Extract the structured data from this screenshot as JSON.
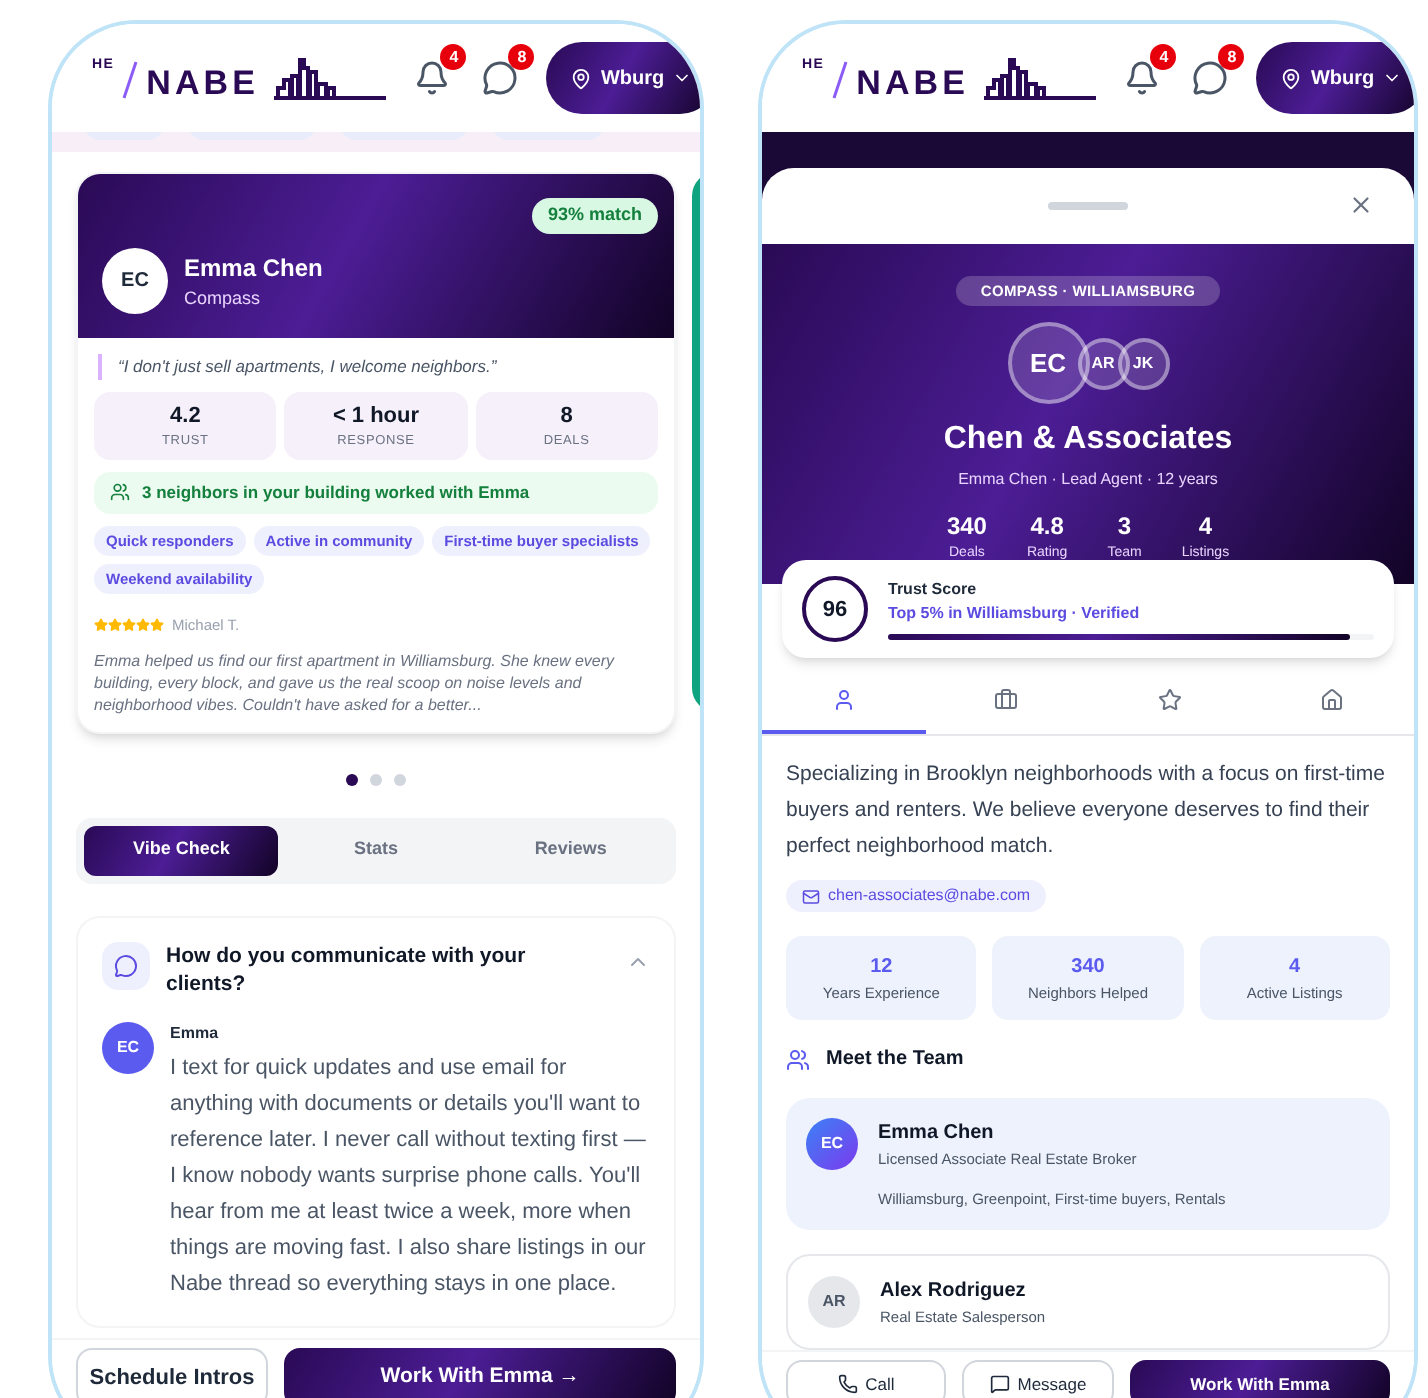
{
  "left": {
    "header": {
      "logo_prefix": "HE",
      "logo_text": "NABE",
      "notifications": "4",
      "messages": "8",
      "location": "Wburg"
    },
    "card": {
      "match": "93% match",
      "initials": "EC",
      "name": "Emma Chen",
      "company": "Compass",
      "quote": "“I don't just sell apartments, I welcome neighbors.”",
      "stats": [
        {
          "value": "4.2",
          "label": "TRUST"
        },
        {
          "value": "< 1 hour",
          "label": "RESPONSE"
        },
        {
          "value": "8",
          "label": "DEALS"
        }
      ],
      "neighbors_note": "3 neighbors in your building worked with Emma",
      "tags": [
        "Quick responders",
        "Active in community",
        "First-time buyer specialists",
        "Weekend availability"
      ],
      "review": {
        "stars": 5,
        "author": "Michael T.",
        "text": "Emma helped us find our first apartment in Williamsburg. She knew every building, every block, and gave us the real scoop on noise levels and neighborhood vibes. Couldn't have asked for a better..."
      }
    },
    "dots": [
      {
        "selected": true
      },
      {
        "selected": false
      },
      {
        "selected": false
      }
    ],
    "tabs": [
      {
        "label": "Vibe Check",
        "selected": true
      },
      {
        "label": "Stats",
        "selected": false
      },
      {
        "label": "Reviews",
        "selected": false
      }
    ],
    "question": {
      "title": "How do you communicate with your clients?",
      "expanded": true,
      "initials": "EC",
      "author": "Emma",
      "answer": "I text for quick updates and use email for anything with documents or details you'll want to reference later. I never call without texting first — I know nobody wants surprise phone calls. You'll hear from me at least twice a week, more when things are moving fast. I also share listings in our Nabe thread so everything stays in one place."
    },
    "actions": {
      "secondary": "Schedule Intros",
      "primary": "Work With Emma →"
    }
  },
  "right": {
    "header": {
      "logo_prefix": "HE",
      "logo_text": "NABE",
      "notifications": "4",
      "messages": "8",
      "location": "Wburg"
    },
    "hero": {
      "badge": "COMPASS · WILLIAMSBURG",
      "avatars": [
        "EC",
        "AR",
        "JK"
      ],
      "title": "Chen & Associates",
      "subtitle": "Emma Chen · Lead Agent · 12 years",
      "stats": [
        {
          "value": "340",
          "label": "Deals"
        },
        {
          "value": "4.8",
          "label": "Rating"
        },
        {
          "value": "3",
          "label": "Team"
        },
        {
          "value": "4",
          "label": "Listings"
        }
      ]
    },
    "trust": {
      "score": "96",
      "title": "Trust Score",
      "detail": "Top 5% in Williamsburg · Verified",
      "level": 0.95
    },
    "icon_tabs": [
      {
        "kind": "person",
        "selected": true
      },
      {
        "kind": "briefcase",
        "selected": false
      },
      {
        "kind": "star",
        "selected": false
      },
      {
        "kind": "home",
        "selected": false
      }
    ],
    "bio": "Specializing in Brooklyn neighborhoods with a focus on first-time buyers and renters. We believe everyone deserves to find their perfect neighborhood match.",
    "email": "chen-associates@nabe.com",
    "stats": [
      {
        "value": "12",
        "label": "Years Experience"
      },
      {
        "value": "340",
        "label": "Neighbors Helped"
      },
      {
        "value": "4",
        "label": "Active Listings"
      }
    ],
    "team_title": "Meet the Team",
    "team": [
      {
        "initials": "EC",
        "name": "Emma Chen",
        "role": "Licensed Associate Real Estate Broker",
        "areas": "Williamsburg, Greenpoint, First-time buyers, Rentals",
        "selected": true
      },
      {
        "initials": "AR",
        "name": "Alex Rodriguez",
        "role": "Real Estate Salesperson",
        "selected": false
      }
    ],
    "actions": {
      "call": "Call",
      "message": "Message",
      "primary": "Work With Emma"
    }
  }
}
